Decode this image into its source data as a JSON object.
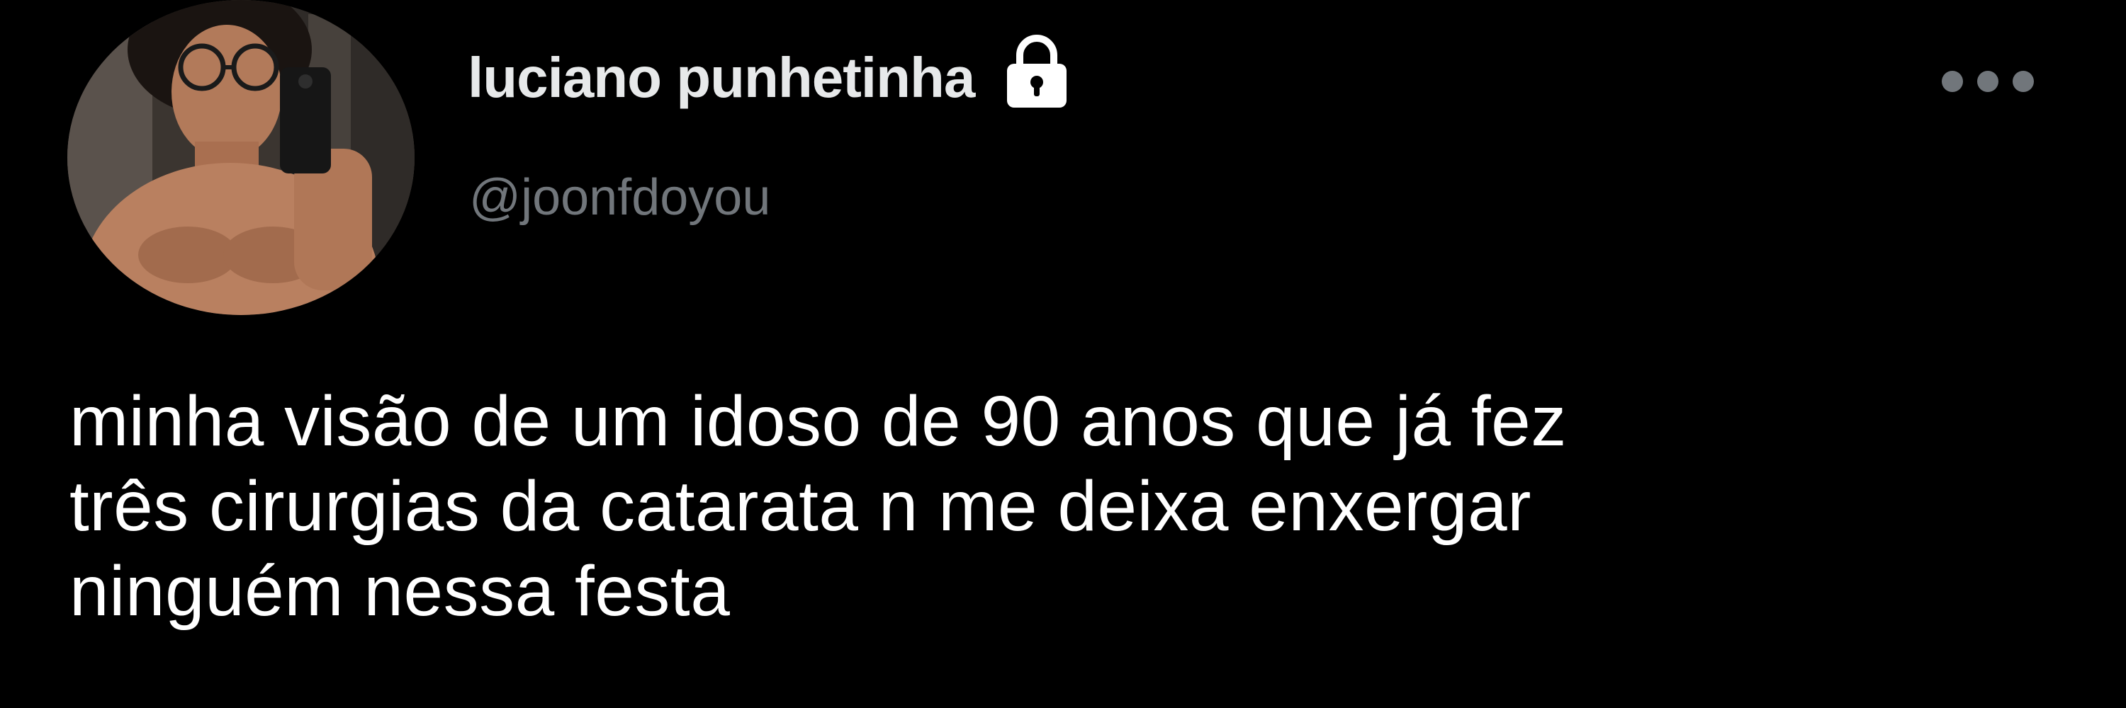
{
  "author": {
    "display_name": "luciano punhetinha",
    "handle": "@joonfdoyou",
    "avatar_icon": "avatar-photo",
    "protected_icon": "lock-icon"
  },
  "more_icon": "more-horizontal-icon",
  "tweet": {
    "lines": [
      "minha visão de um idoso de 90 anos que já fez",
      "três cirurgias da catarata n me deixa enxergar",
      "ninguém nessa festa"
    ]
  },
  "colors": {
    "background": "#000000",
    "display_name": "#e7e9ea",
    "handle": "#71767b",
    "text": "#ffffff"
  }
}
